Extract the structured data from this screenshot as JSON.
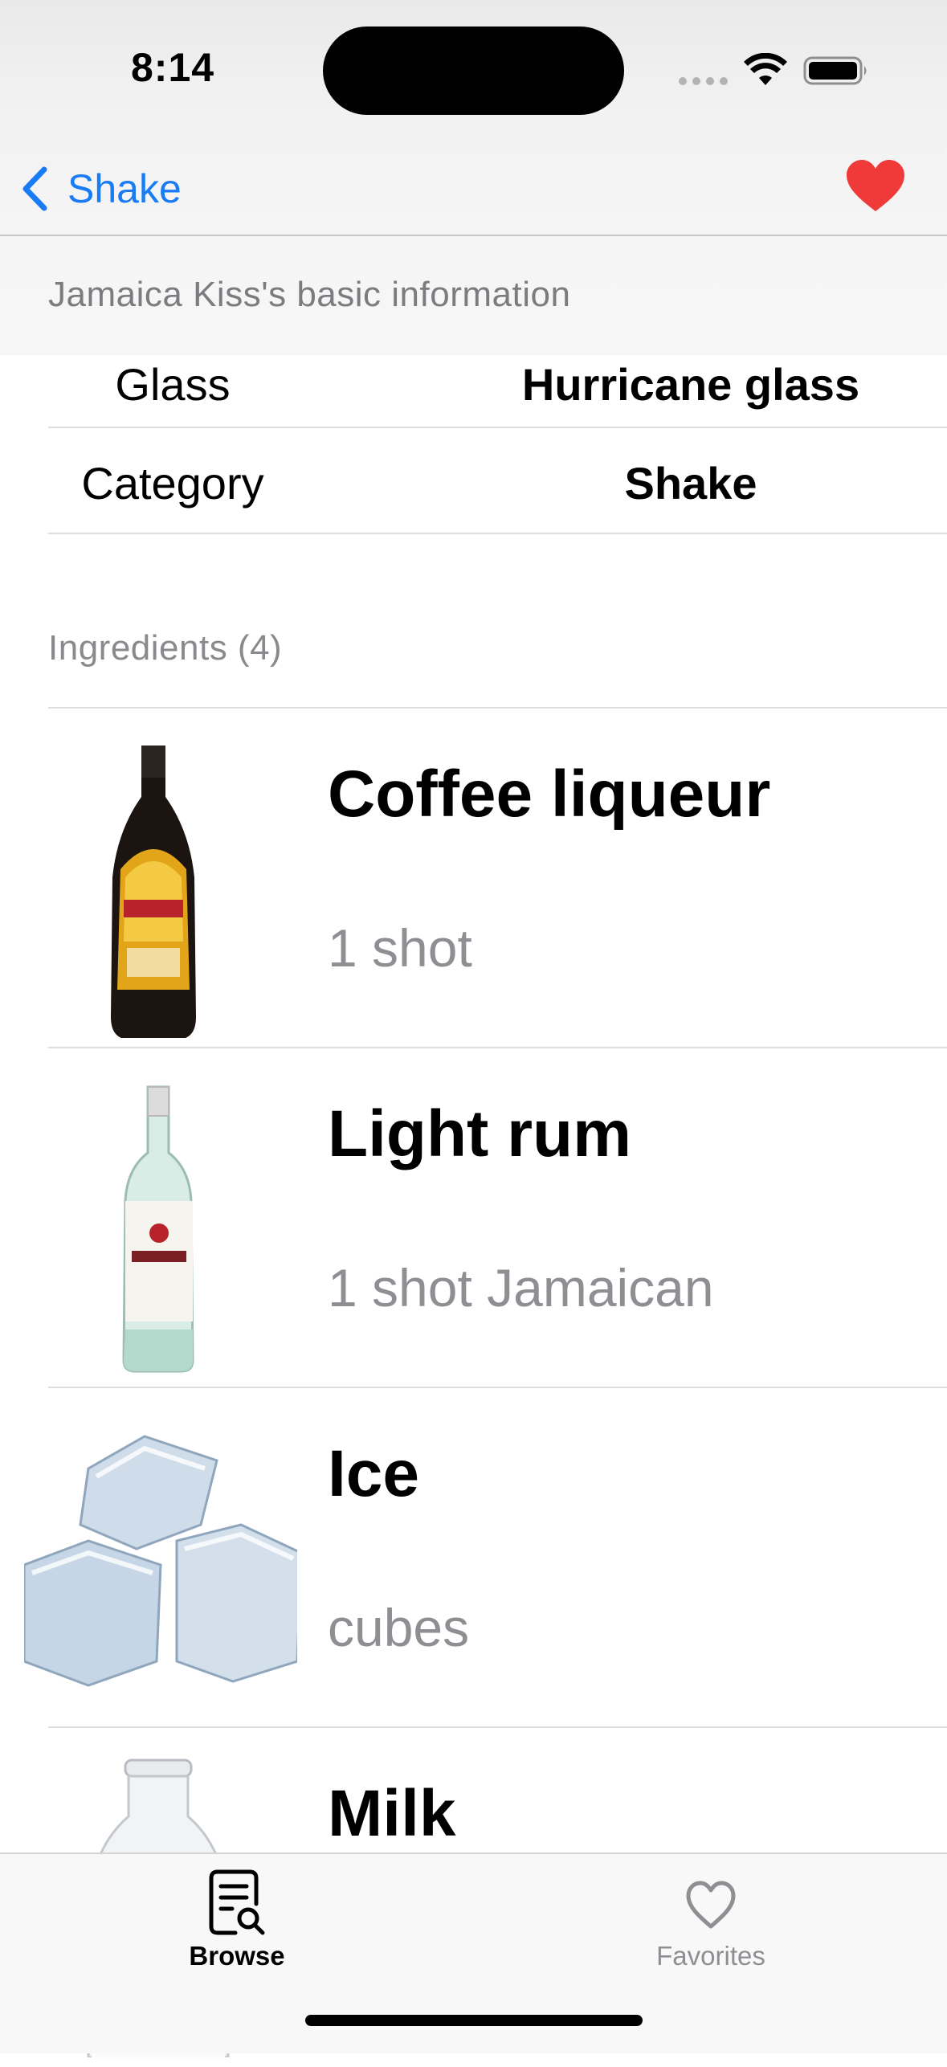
{
  "status_bar": {
    "time": "8:14"
  },
  "nav": {
    "back_label": "Shake",
    "favorite_icon": "heart-filled-icon",
    "favorite_color": "#f03a3a",
    "accent_color": "#1a7cf5"
  },
  "basic_info": {
    "header": "Jamaica Kiss's basic information",
    "rows": [
      {
        "label": "Glass",
        "value": "Hurricane glass"
      },
      {
        "label": "Category",
        "value": "Shake"
      }
    ]
  },
  "ingredients": {
    "header": "Ingredients (4)",
    "items": [
      {
        "name": "Coffee liqueur",
        "measure": "1 shot",
        "image": "coffee-liqueur-bottle-image"
      },
      {
        "name": "Light rum",
        "measure": "1 shot Jamaican",
        "image": "light-rum-bottle-image"
      },
      {
        "name": "Ice",
        "measure": "cubes",
        "image": "ice-cubes-image"
      },
      {
        "name": "Milk",
        "measure": "",
        "image": "milk-bottle-image"
      }
    ]
  },
  "tab_bar": {
    "tabs": [
      {
        "label": "Browse",
        "icon": "browse-document-search-icon",
        "selected": true
      },
      {
        "label": "Favorites",
        "icon": "heart-outline-icon",
        "selected": false
      }
    ]
  }
}
